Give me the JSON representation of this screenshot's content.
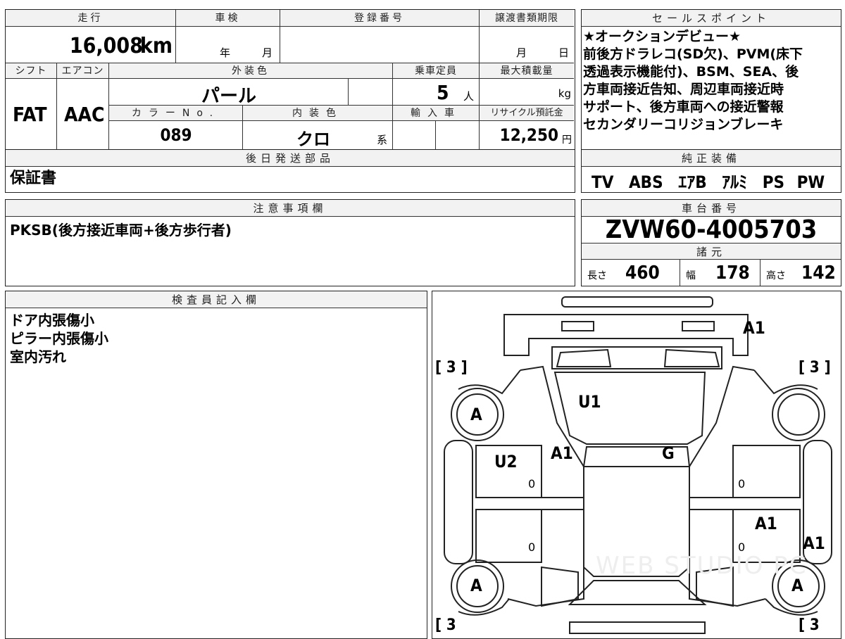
{
  "top": {
    "mileage_label": "走行",
    "mileage_value": "16,008",
    "mileage_unit": "km",
    "shaken_label": "車検",
    "shaken_year": "年",
    "shaken_month": "月",
    "reg_label": "登録番号",
    "deadline_label": "譲渡書類期限",
    "deadline_month": "月",
    "deadline_day": "日",
    "shift_label": "シフト",
    "ac_label": "エアコン",
    "exterior_label": "外装色",
    "capacity_label": "乗車定員",
    "maxload_label": "最大積載量",
    "shift_value": "FAT",
    "ac_value": "AAC",
    "exterior_value": "パール",
    "capacity_value": "5",
    "capacity_unit": "人",
    "maxload_unit": "kg",
    "colorno_label": "カラーNo.",
    "interior_label": "内装色",
    "import_label": "輸入車",
    "recycle_label": "リサイクル預託金",
    "colorno_value": "089",
    "interior_value": "クロ",
    "interior_suffix": "系",
    "recycle_value": "12,250",
    "recycle_unit": "円"
  },
  "sales": {
    "label": "セールスポイント",
    "lines": [
      "★オークションデビュー★",
      "前後方ドラレコ(SD欠)、PVM(床下",
      "透過表示機能付)、BSM、SEA、後",
      "方車両接近告知、周辺車両接近時",
      "サポート、後方車両への接近警報",
      "セカンダリーコリジョンブレーキ"
    ]
  },
  "shipping": {
    "label": "後日発送部品",
    "value": "保証書"
  },
  "equipment": {
    "label": "純正装備",
    "items": [
      "TV",
      "ABS",
      "ｴｱB",
      "ｱﾙﾐ",
      "PS",
      "PW"
    ]
  },
  "notes": {
    "label": "注意事項欄",
    "value": "PKSB(後方接近車両+後方歩行者)"
  },
  "chassis": {
    "label": "車台番号",
    "value": "ZVW60-4005703"
  },
  "specs": {
    "label": "諸元",
    "length_label": "長さ",
    "length_value": "460",
    "width_label": "幅",
    "width_value": "178",
    "height_label": "高さ",
    "height_value": "142"
  },
  "inspector": {
    "label": "検査員記入欄",
    "lines": [
      "ドア内張傷小",
      "ピラー内張傷小",
      "室内汚れ"
    ]
  },
  "diagram": {
    "marks": {
      "a1_top": "A1",
      "u1": "U1",
      "a1_center": "A1",
      "g": "G",
      "u2": "U2",
      "a1_right_door": "A1",
      "a1_right_edge": "A1",
      "tire_fl": "A",
      "tire_rl": "A",
      "tire_rr": "A",
      "bracket_tl": "[ 3 ]",
      "bracket_tr": "[ 3 ]",
      "bracket_bl": "[ 3",
      "bracket_br": "[ 3",
      "zero": "0"
    },
    "watermark": "WEB STUDIO PC"
  },
  "colors": {
    "border": "#222222",
    "header_bg": "#f2f2f2",
    "text": "#000000"
  }
}
